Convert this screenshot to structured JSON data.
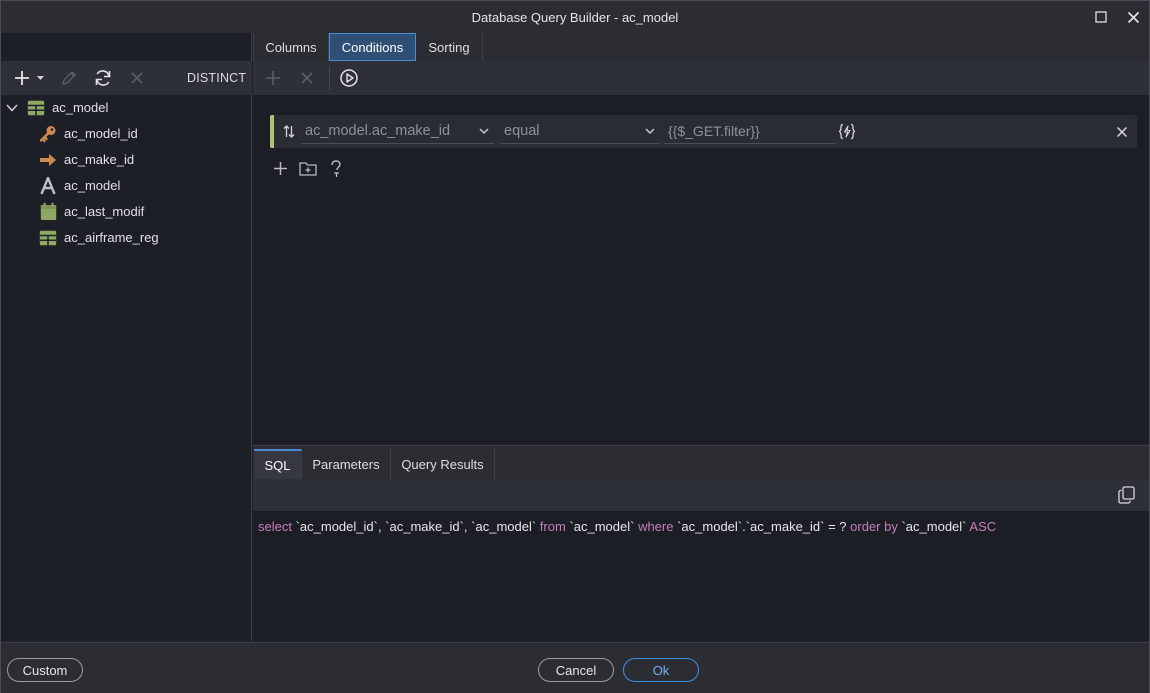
{
  "window": {
    "title": "Database Query Builder - ac_model"
  },
  "tabs": [
    {
      "label": "Columns"
    },
    {
      "label": "Conditions",
      "active": true
    },
    {
      "label": "Sorting"
    }
  ],
  "left_toolbar": {
    "distinct_label": "DISTINCT"
  },
  "tree": {
    "root": {
      "label": "ac_model",
      "icon": "table-icon"
    },
    "columns": [
      {
        "label": "ac_model_id",
        "icon": "key-icon"
      },
      {
        "label": "ac_make_id",
        "icon": "foreign-key-arrow-icon"
      },
      {
        "label": "ac_model",
        "icon": "text-type-icon"
      },
      {
        "label": "ac_last_modif",
        "icon": "calendar-icon"
      },
      {
        "label": "ac_airframe_reg",
        "icon": "table-icon"
      }
    ]
  },
  "condition": {
    "field": "ac_model.ac_make_id",
    "operator": "equal",
    "value": "{{$_GET.filter}}"
  },
  "bottom_tabs": [
    {
      "label": "SQL",
      "active": true
    },
    {
      "label": "Parameters"
    },
    {
      "label": "Query Results"
    }
  ],
  "sql": {
    "parts": [
      {
        "t": "select ",
        "c": "kw"
      },
      {
        "t": "`ac_model_id`, `ac_make_id`, `ac_model`",
        "c": "id"
      },
      {
        "t": " from ",
        "c": "kw"
      },
      {
        "t": "`ac_model`",
        "c": "id"
      },
      {
        "t": " where ",
        "c": "kw"
      },
      {
        "t": "`ac_model`.`ac_make_id` = ?",
        "c": "id"
      },
      {
        "t": " order by ",
        "c": "kw"
      },
      {
        "t": "`ac_model`",
        "c": "id"
      },
      {
        "t": " ASC",
        "c": "kw"
      }
    ]
  },
  "footer": {
    "custom_label": "Custom",
    "cancel_label": "Cancel",
    "ok_label": "Ok"
  },
  "colors": {
    "accent": "#4a8bd6",
    "condition_bar": "#b7be77",
    "sql_keyword": "#c77dbb"
  }
}
